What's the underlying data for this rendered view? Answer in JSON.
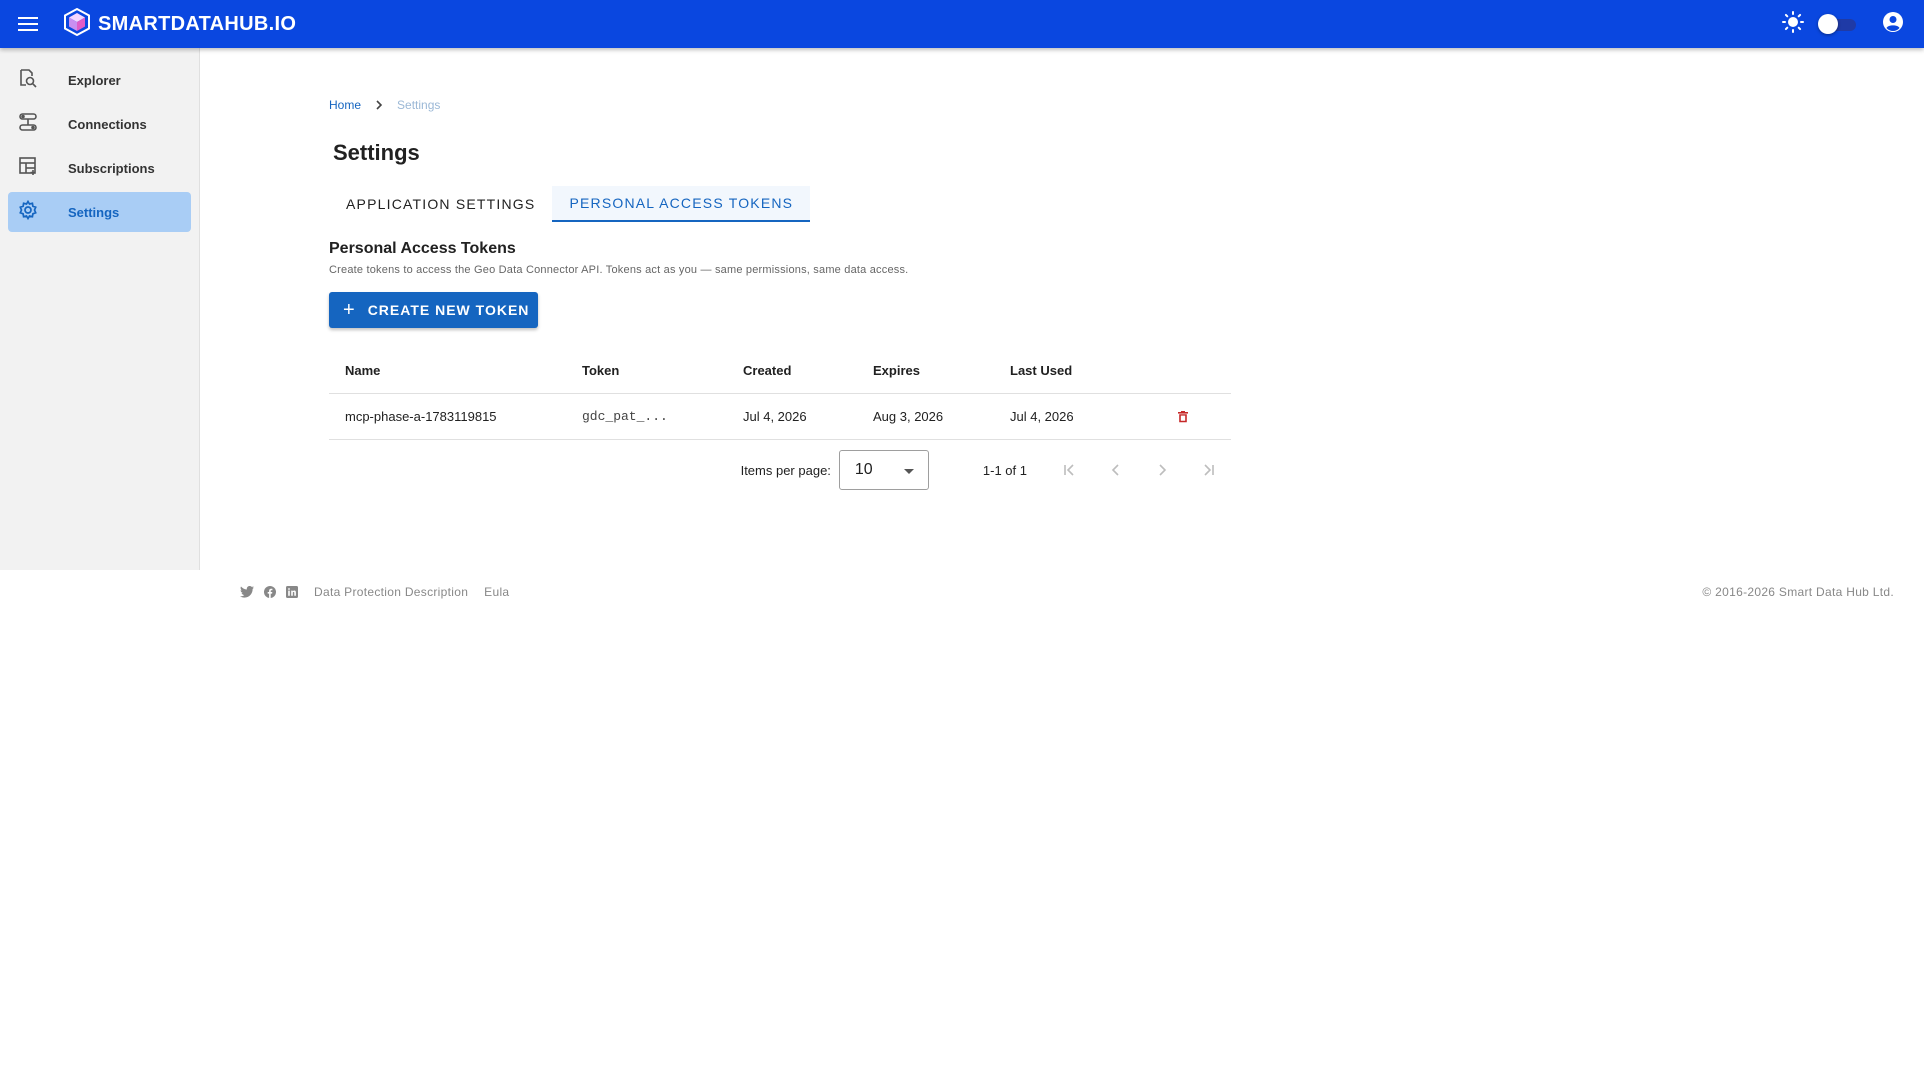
{
  "app": {
    "brand": "SMARTDATAHUB.IO"
  },
  "sidebar": {
    "items": [
      {
        "label": "Explorer",
        "icon": "explorer-search-icon",
        "active": false
      },
      {
        "label": "Connections",
        "icon": "connections-icon",
        "active": false
      },
      {
        "label": "Subscriptions",
        "icon": "subscriptions-icon",
        "active": false
      },
      {
        "label": "Settings",
        "icon": "gear-icon",
        "active": true
      }
    ]
  },
  "breadcrumb": {
    "home": "Home",
    "current": "Settings"
  },
  "page": {
    "title": "Settings"
  },
  "tabs": [
    {
      "label": "APPLICATION SETTINGS",
      "active": false
    },
    {
      "label": "PERSONAL ACCESS TOKENS",
      "active": true
    }
  ],
  "section": {
    "title": "Personal Access Tokens",
    "description": "Create tokens to access the Geo Data Connector API. Tokens act as you — same permissions, same data access.",
    "create_button": "CREATE NEW TOKEN"
  },
  "table": {
    "headers": {
      "name": "Name",
      "token": "Token",
      "created": "Created",
      "expires": "Expires",
      "last_used": "Last Used"
    },
    "rows": [
      {
        "name": "mcp-phase-a-1783119815",
        "token": "gdc_pat_...",
        "created": "Jul 4, 2026",
        "expires": "Aug 3, 2026",
        "last_used": "Jul 4, 2026"
      }
    ]
  },
  "paginator": {
    "label": "Items per page:",
    "page_size": "10",
    "range": "1-1 of 1"
  },
  "footer": {
    "links": [
      "Data Protection Description",
      "Eula"
    ],
    "copyright": "© 2016-2026 Smart Data Hub Ltd."
  },
  "colors": {
    "appbar": "#0a47e0",
    "accent": "#1565c0",
    "active_nav": "#a9cdf5",
    "delete": "#c62828"
  }
}
